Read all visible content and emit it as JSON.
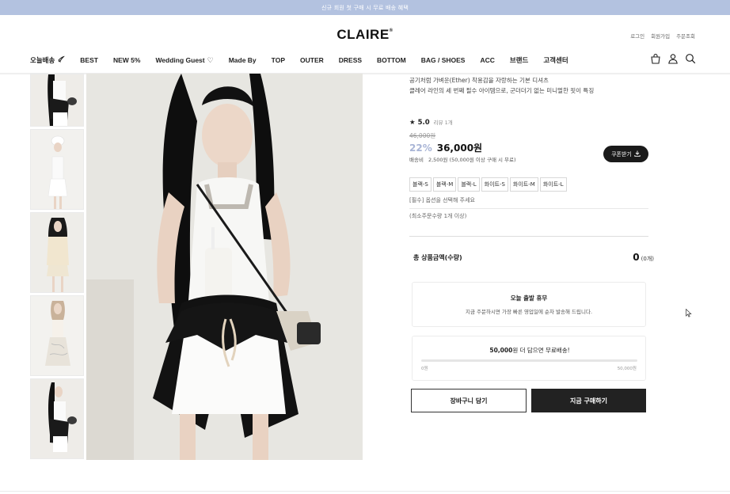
{
  "promo": {
    "text": "신규 회원 첫 구매 시 무료 배송 혜택"
  },
  "brand": {
    "logo": "CLAIRE",
    "mark": "®"
  },
  "util_links": [
    "로그인",
    "회원가입",
    "주문조회"
  ],
  "nav": [
    {
      "label": "오늘배송",
      "icon": "rocket-icon",
      "glyph": "🚀"
    },
    {
      "label": "BEST"
    },
    {
      "label": "NEW 5%"
    },
    {
      "label": "Wedding Guest",
      "glyph": "♡"
    },
    {
      "label": "Made By"
    },
    {
      "label": "TOP"
    },
    {
      "label": "OUTER"
    },
    {
      "label": "DRESS"
    },
    {
      "label": "BOTTOM"
    },
    {
      "label": "BAG / SHOES"
    },
    {
      "label": "ACC"
    },
    {
      "label": "브랜드"
    },
    {
      "label": "고객센터"
    }
  ],
  "header_icons": [
    "shopping-bag-icon",
    "user-icon",
    "search-icon"
  ],
  "product": {
    "desc_line1": "공기처럼 가벼운(Ether) 착용감을 자랑하는 기본 디셔츠",
    "desc_line2": "클레어 라인의 세 번째 필수 아이템으로, 군더더기 없는 미니멀한 핏이 특징",
    "rating": "★ 5.0",
    "reviews": "리뷰 1개",
    "original_price": "46,000원",
    "discount": "22%",
    "price": "36,000원",
    "shipping_label": "배송비",
    "shipping_value": "2,500원 (50,000원 이상 구매 시 무료)",
    "coupon_label": "쿠폰받기",
    "options": [
      "블랙-S",
      "블랙-M",
      "블랙-L",
      "화이트-S",
      "화이트-M",
      "화이트-L"
    ],
    "option_required": "[필수] 옵션을 선택해 주세요",
    "min_qty": "(최소주문수량 1개 이상)"
  },
  "total": {
    "label": "총 상품금액(수량)",
    "amount": "0",
    "count": "(0개)"
  },
  "notice": {
    "title": "오늘 출발 휴무",
    "text": "지금 주문하시면 가장 빠른 영업일에 순차 발송해 드립니다."
  },
  "freeship": {
    "amount": "50,000",
    "text": "원 더 담으면 무료배송!",
    "min": "0원",
    "max": "50,000원",
    "progress": 0
  },
  "buttons": {
    "cart": "장바구니 담기",
    "buy": "지금 구매하기"
  },
  "colors": {
    "accent": "#a9b5d6",
    "promo_bar": "#b3c2e0",
    "dark": "#222222"
  }
}
